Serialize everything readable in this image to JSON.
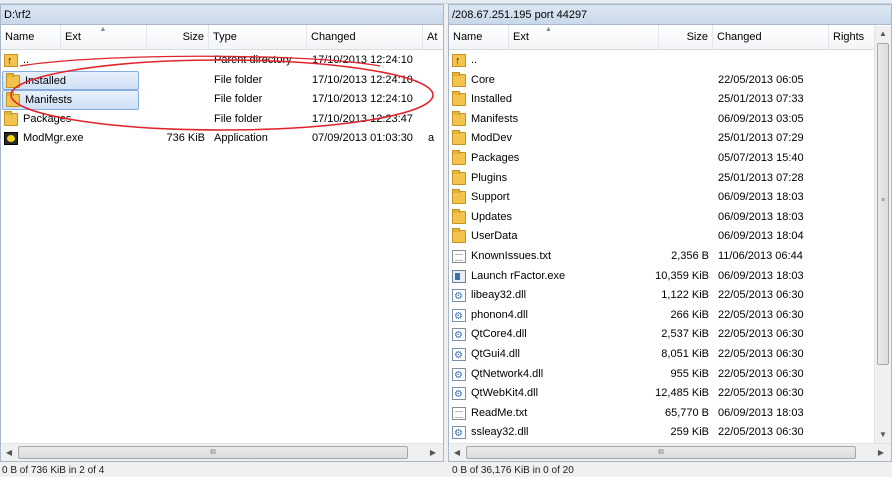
{
  "left_panel": {
    "path": "D:\\rf2",
    "columns": {
      "name": "Name",
      "ext": "Ext",
      "size": "Size",
      "type": "Type",
      "changed": "Changed",
      "attr": "At"
    },
    "rows": [
      {
        "name": "..",
        "size": "",
        "type": "Parent directory",
        "changed": "17/10/2013 12:24:10",
        "attr": "",
        "icon": "parent-dir-icon"
      },
      {
        "name": "Installed",
        "size": "",
        "type": "File folder",
        "changed": "17/10/2013 12:24:10",
        "attr": "",
        "icon": "folder-icon"
      },
      {
        "name": "Manifests",
        "size": "",
        "type": "File folder",
        "changed": "17/10/2013 12:24:10",
        "attr": "",
        "icon": "folder-icon"
      },
      {
        "name": "Packages",
        "size": "",
        "type": "File folder",
        "changed": "17/10/2013 12:23:47",
        "attr": "",
        "icon": "folder-icon"
      },
      {
        "name": "ModMgr.exe",
        "size": "736 KiB",
        "type": "Application",
        "changed": "07/09/2013 01:03:30",
        "attr": "a",
        "icon": "exe-icon"
      }
    ],
    "status": "0 B of 736 KiB in 2 of 4"
  },
  "right_panel": {
    "path": "/208.67.251.195 port 44297",
    "columns": {
      "name": "Name",
      "ext": "Ext",
      "size": "Size",
      "changed": "Changed",
      "rights": "Rights"
    },
    "rows": [
      {
        "name": "..",
        "size": "",
        "changed": "",
        "icon": "parent-dir-icon"
      },
      {
        "name": "Core",
        "size": "",
        "changed": "22/05/2013 06:05",
        "icon": "folder-icon"
      },
      {
        "name": "Installed",
        "size": "",
        "changed": "25/01/2013 07:33",
        "icon": "folder-icon"
      },
      {
        "name": "Manifests",
        "size": "",
        "changed": "06/09/2013 03:05",
        "icon": "folder-icon"
      },
      {
        "name": "ModDev",
        "size": "",
        "changed": "25/01/2013 07:29",
        "icon": "folder-icon"
      },
      {
        "name": "Packages",
        "size": "",
        "changed": "05/07/2013 15:40",
        "icon": "folder-icon"
      },
      {
        "name": "Plugins",
        "size": "",
        "changed": "25/01/2013 07:28",
        "icon": "folder-icon"
      },
      {
        "name": "Support",
        "size": "",
        "changed": "06/09/2013 18:03",
        "icon": "folder-icon"
      },
      {
        "name": "Updates",
        "size": "",
        "changed": "06/09/2013 18:03",
        "icon": "folder-icon"
      },
      {
        "name": "UserData",
        "size": "",
        "changed": "06/09/2013 18:04",
        "icon": "folder-icon"
      },
      {
        "name": "KnownIssues.txt",
        "size": "2,356 B",
        "changed": "11/06/2013 06:44",
        "icon": "text-file-icon"
      },
      {
        "name": "Launch rFactor.exe",
        "size": "10,359 KiB",
        "changed": "06/09/2013 18:03",
        "icon": "application-icon"
      },
      {
        "name": "libeay32.dll",
        "size": "1,122 KiB",
        "changed": "22/05/2013 06:30",
        "icon": "dll-icon"
      },
      {
        "name": "phonon4.dll",
        "size": "266 KiB",
        "changed": "22/05/2013 06:30",
        "icon": "dll-icon"
      },
      {
        "name": "QtCore4.dll",
        "size": "2,537 KiB",
        "changed": "22/05/2013 06:30",
        "icon": "dll-icon"
      },
      {
        "name": "QtGui4.dll",
        "size": "8,051 KiB",
        "changed": "22/05/2013 06:30",
        "icon": "dll-icon"
      },
      {
        "name": "QtNetwork4.dll",
        "size": "955 KiB",
        "changed": "22/05/2013 06:30",
        "icon": "dll-icon"
      },
      {
        "name": "QtWebKit4.dll",
        "size": "12,485 KiB",
        "changed": "22/05/2013 06:30",
        "icon": "dll-icon"
      },
      {
        "name": "ReadMe.txt",
        "size": "65,770 B",
        "changed": "06/09/2013 18:03",
        "icon": "text-file-icon"
      },
      {
        "name": "ssleay32.dll",
        "size": "259 KiB",
        "changed": "22/05/2013 06:30",
        "icon": "dll-icon"
      }
    ],
    "status": "0 B of 36,176 KiB in 0 of 20"
  },
  "scrollbar_glyphs": {
    "left": "◀",
    "right": "▶",
    "up": "▲",
    "down": "▼",
    "thumb": "III"
  },
  "colors": {
    "annotation_circle": "#e0242c",
    "selection_border": "#84acdd"
  }
}
